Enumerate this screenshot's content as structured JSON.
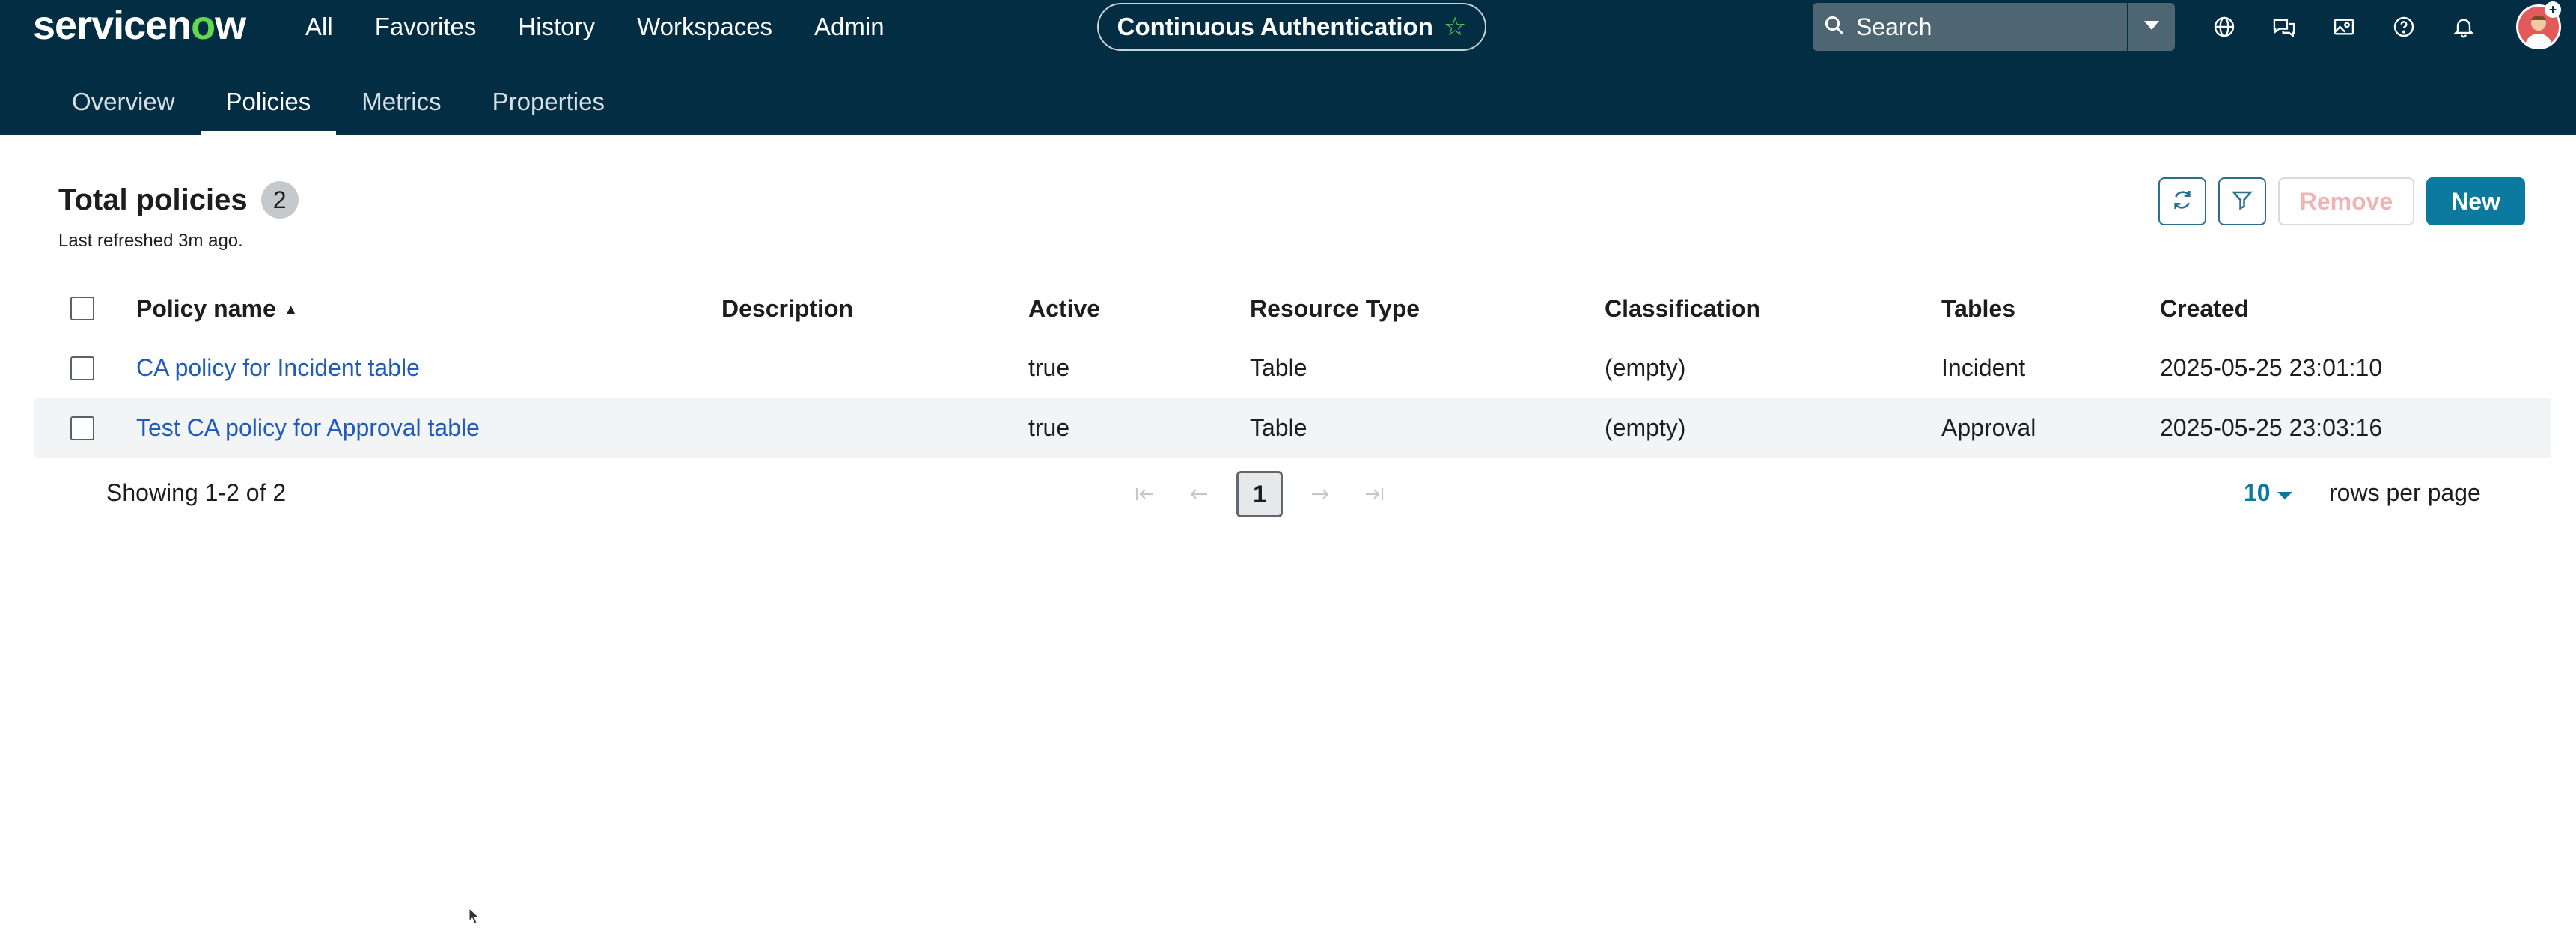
{
  "header": {
    "logo_prefix": "servicen",
    "logo_o": "o",
    "logo_suffix": "w",
    "nav": [
      "All",
      "Favorites",
      "History",
      "Workspaces",
      "Admin"
    ],
    "context_title": "Continuous Authentication",
    "context_star_icon": "star-outline-icon",
    "search": {
      "placeholder": "Search",
      "value": ""
    },
    "icons": [
      "globe-icon",
      "chat-icon",
      "image-card-icon",
      "help-icon",
      "bell-icon"
    ],
    "avatar_badge": "+",
    "colors": {
      "bg": "#032d42",
      "accent": "#62d84e",
      "link": "#1f5bbd",
      "primary": "#0c7a9e"
    }
  },
  "tabs": [
    {
      "label": "Overview",
      "active": false
    },
    {
      "label": "Policies",
      "active": true
    },
    {
      "label": "Metrics",
      "active": false
    },
    {
      "label": "Properties",
      "active": false
    }
  ],
  "list": {
    "title": "Total policies",
    "count": "2",
    "last_refreshed": "Last refreshed 3m ago.",
    "actions": {
      "refresh_icon": "refresh-icon",
      "filter_icon": "filter-icon",
      "remove_label": "Remove",
      "new_label": "New"
    },
    "columns": {
      "name": "Policy name",
      "description": "Description",
      "active": "Active",
      "resource_type": "Resource Type",
      "classification": "Classification",
      "tables": "Tables",
      "created": "Created"
    },
    "rows": [
      {
        "name": "CA policy for Incident table",
        "description": "",
        "active": "true",
        "resource_type": "Table",
        "classification": "(empty)",
        "tables": "Incident",
        "created": "2025-05-25 23:01:10"
      },
      {
        "name": "Test CA policy for Approval table",
        "description": "",
        "active": "true",
        "resource_type": "Table",
        "classification": "(empty)",
        "tables": "Approval",
        "created": "2025-05-25 23:03:16"
      }
    ],
    "pagination": {
      "showing": "Showing 1-2 of 2",
      "current_page": "1",
      "rows_per_page_value": "10",
      "rows_per_page_label": "rows per page"
    }
  }
}
